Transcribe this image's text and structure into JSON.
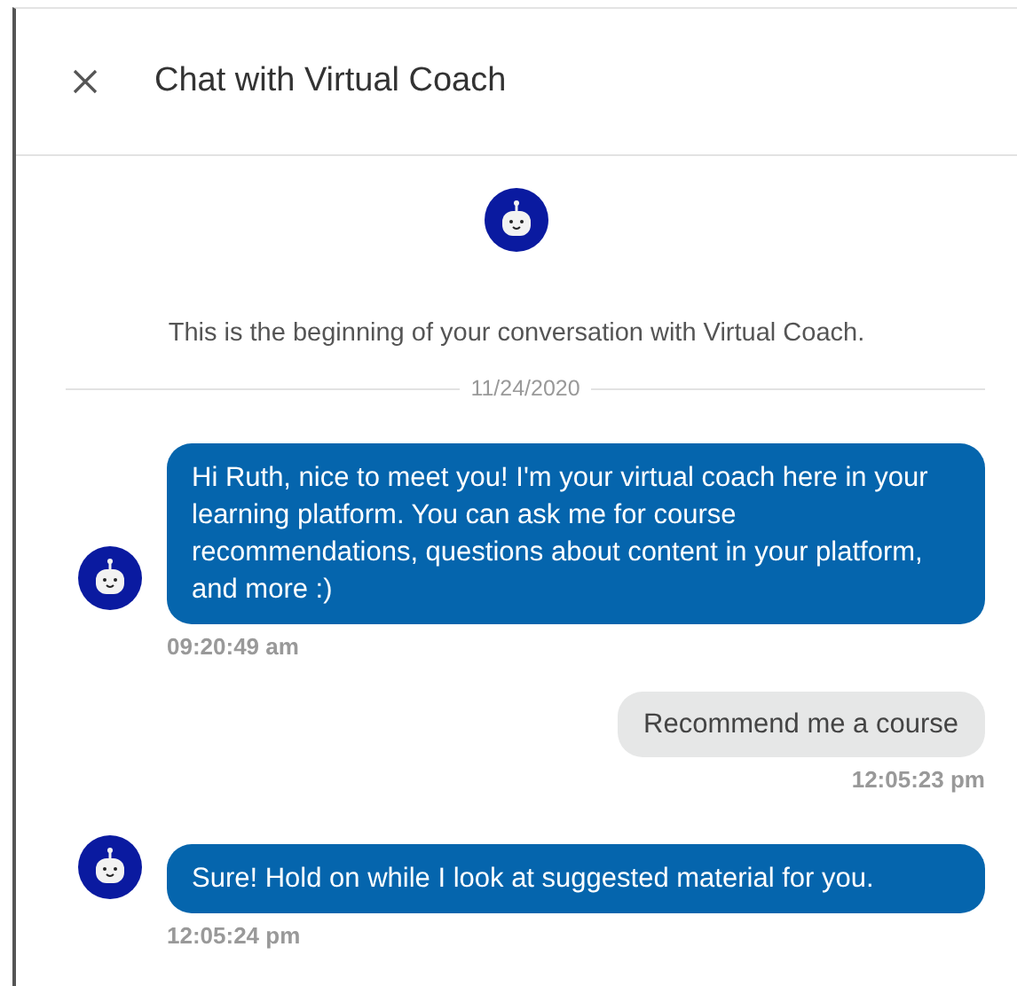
{
  "header": {
    "title": "Chat with Virtual Coach"
  },
  "intro": "This is the beginning of your conversation with Virtual Coach.",
  "date": "11/24/2020",
  "messages": [
    {
      "kind": "bot",
      "text": "Hi Ruth, nice to meet you! I'm your virtual coach here in your learning platform. You can ask me for course recommendations, questions about content in your platform, and more :)",
      "time": "09:20:49 am"
    },
    {
      "kind": "user",
      "text": "Recommend me a course",
      "time": "12:05:23 pm"
    },
    {
      "kind": "bot",
      "text": "Sure! Hold on while I look at suggested material for you.",
      "time": "12:05:24 pm"
    }
  ]
}
